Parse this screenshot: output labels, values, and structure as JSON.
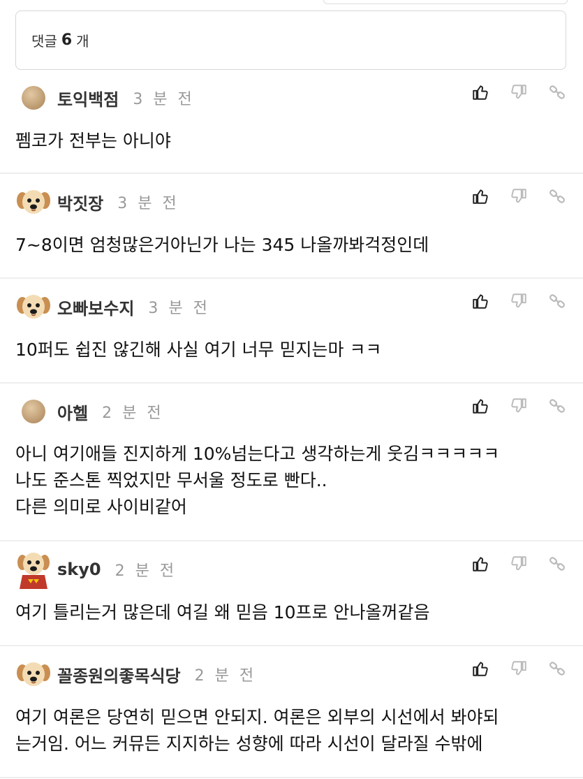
{
  "header": {
    "count_prefix": "댓글",
    "count_value": "6",
    "count_suffix": "개"
  },
  "comments": [
    {
      "author": "토익백점",
      "time": "3 분 전",
      "avatar": "beige-circle-avatar",
      "text": "펨코가 전부는 아니야"
    },
    {
      "author": "박짓장",
      "time": "3 분 전",
      "avatar": "puppy-avatar",
      "text": "7~8이면 엄청많은거아닌가 나는 345 나올까봐걱정인데"
    },
    {
      "author": "오빠보수지",
      "time": "3 분 전",
      "avatar": "puppy-avatar",
      "text": "10퍼도 쉽진 않긴해 사실 여기 너무 믿지는마 ㅋㅋ"
    },
    {
      "author": "아헬",
      "time": "2 분 전",
      "avatar": "beige-circle-avatar",
      "text": "아니 여기애들 진지하게 10%넘는다고 생각하는게 웃김ㅋㅋㅋㅋㅋ\n나도 준스톤 찍었지만 무서울 정도로 빤다..\n다른 의미로 사이비같어"
    },
    {
      "author": "sky0",
      "time": "2 분 전",
      "avatar": "puppy-cape-avatar",
      "text": "여기 틀리는거 많은데 여길 왜 믿음 10프로 안나올꺼같음"
    },
    {
      "author": "꼴종원의좋목식당",
      "time": "2 분 전",
      "avatar": "puppy-avatar",
      "text": "여기 여론은 당연히 믿으면 안되지. 여론은 외부의 시선에서 봐야되\n는거임. 어느 커뮤든 지지하는 성향에 따라 시선이 달라질 수밖에"
    }
  ],
  "icons": {
    "like": "thumbs-up-icon",
    "dislike": "thumbs-down-icon",
    "share": "link-icon"
  },
  "colors": {
    "author": "#333333",
    "time": "#999999",
    "like_icon": "#222222",
    "inactive_icon": "#bbbbbb",
    "avatar_beige": "#c9a87c"
  }
}
